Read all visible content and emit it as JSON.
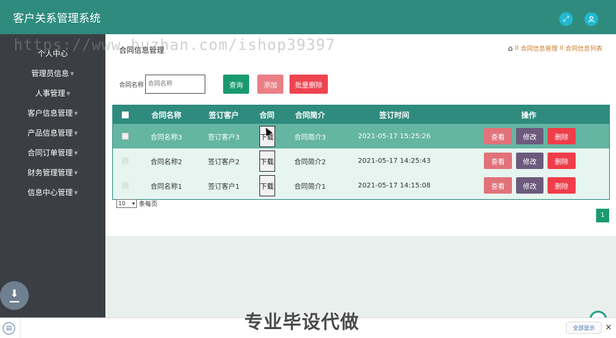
{
  "header": {
    "title": "客户关系管理系统",
    "icons": [
      "expand-icon",
      "user-icon"
    ]
  },
  "sidebar": {
    "items": [
      {
        "label": "个人中心"
      },
      {
        "label": "管理员信息"
      },
      {
        "label": "人事管理"
      },
      {
        "label": "客户信息管理"
      },
      {
        "label": "产品信息管理"
      },
      {
        "label": "合同订单管理"
      },
      {
        "label": "财务管理管理"
      },
      {
        "label": "信息中心管理"
      }
    ]
  },
  "main": {
    "page_title": "合同信息管理",
    "breadcrumb": {
      "sep": "II",
      "level1": "合同信息管理",
      "level2": "合同信息列表"
    },
    "search": {
      "label": "合同名称",
      "placeholder": "合同名称"
    },
    "buttons": {
      "query": "查询",
      "add": "添加",
      "batch_delete": "批量删除"
    },
    "table": {
      "columns": [
        "合同名称",
        "签订客户",
        "合同",
        "合同简介",
        "签订时间",
        "操作"
      ],
      "rows": [
        {
          "name": "合同名称3",
          "customer": "签订客户3",
          "file_btn": "下载",
          "intro": "合同简介3",
          "time": "2021-05-17 15:25:26"
        },
        {
          "name": "合同名称2",
          "customer": "签订客户2",
          "file_btn": "下载",
          "intro": "合同简介2",
          "time": "2021-05-17 14:25:43"
        },
        {
          "name": "合同名称1",
          "customer": "签订客户1",
          "file_btn": "下载",
          "intro": "合同简介1",
          "time": "2021-05-17 14:15:08"
        }
      ],
      "actions": {
        "view": "查看",
        "edit": "修改",
        "delete": "删除"
      }
    },
    "pager": {
      "page_size": "10",
      "per_page_label": "条每页",
      "current_page": "1"
    }
  },
  "bottom_bar": {
    "show_all": "全部显示",
    "close": "×"
  },
  "overlays": {
    "watermark_url": "https://www.huzhan.com/ishop39397",
    "banner": "专业毕设代做"
  },
  "colors": {
    "primary": "#2e8b7e",
    "sidebar": "#3b3f44",
    "danger": "#ef3d4a",
    "edit": "#6c5a7d"
  }
}
